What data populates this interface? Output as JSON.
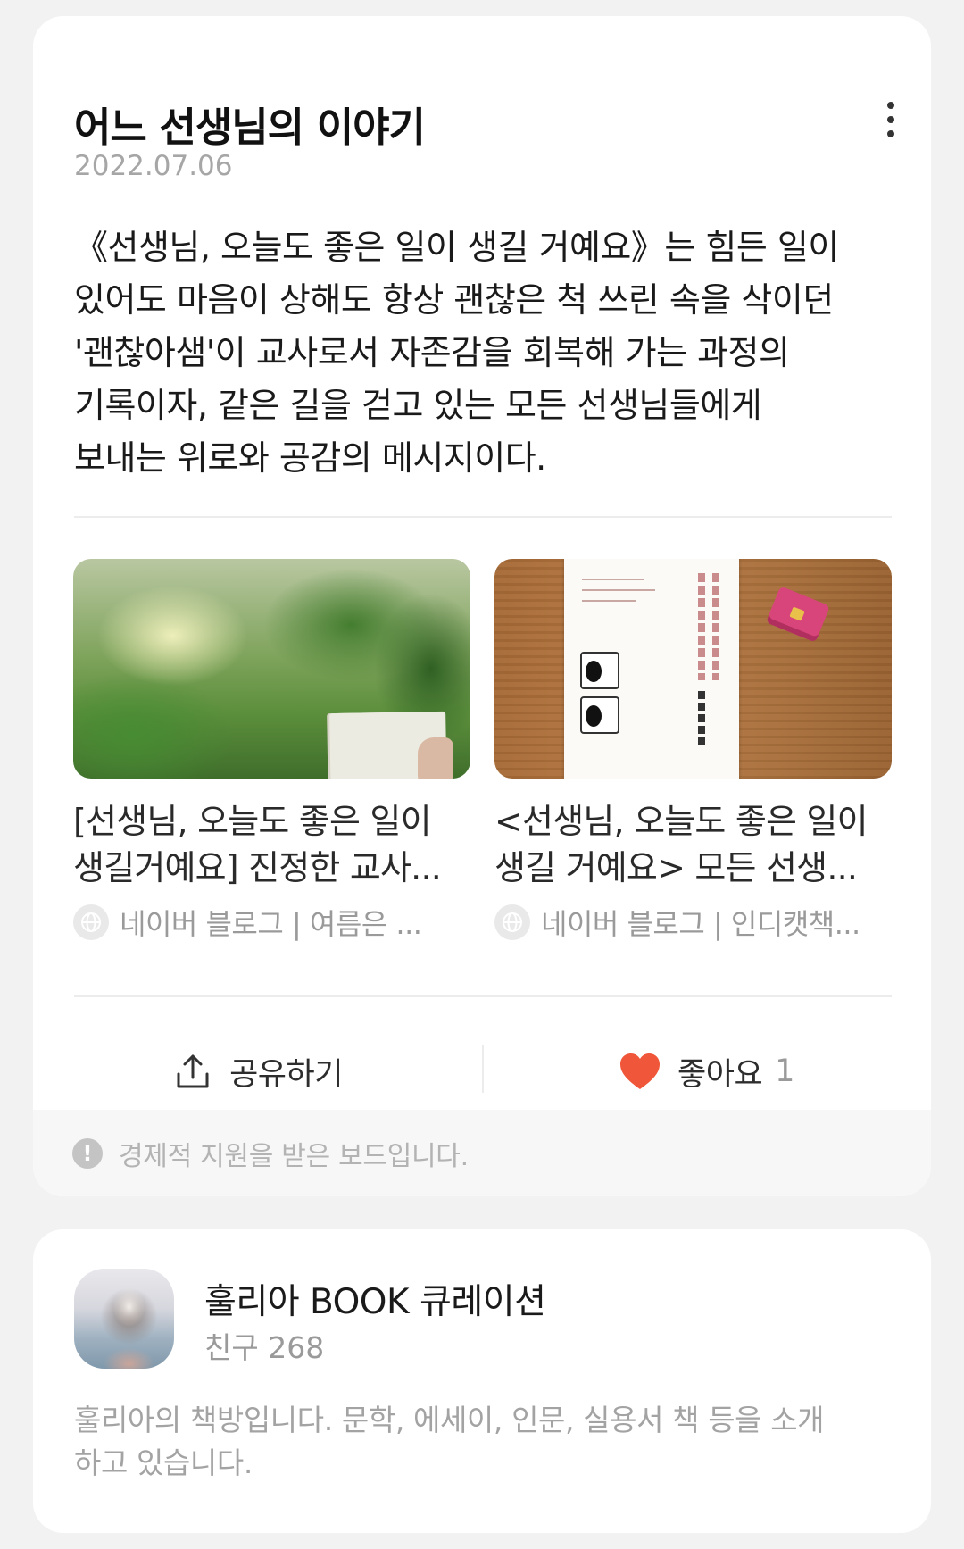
{
  "post": {
    "title": "어느 선생님의 이야기",
    "date": "2022.07.06",
    "body_lines": [
      "《선생님, 오늘도 좋은 일이 생길 거예요》는 힘든 일이",
      "있어도 마음이 상해도 항상 괜찮은 척 쓰린 속을 삭이던",
      "'괜찮아샘'이 교사로서 자존감을 회복해 가는 과정의",
      "기록이자, 같은 길을 걷고 있는 모든 선생님들에게",
      "보내는 위로와 공감의 메시지이다."
    ],
    "more_icon": "more-vertical-icon"
  },
  "links": [
    {
      "title_lines": [
        "[선생님, 오늘도 좋은 일이",
        "생길거예요] 진정한 교사..."
      ],
      "source": "네이버 블로그 | 여름은 ...",
      "icon": "globe-icon"
    },
    {
      "title_lines": [
        "<선생님, 오늘도 좋은 일이",
        "생길 거예요> 모든 선생..."
      ],
      "source": "네이버 블로그 | 인디캣책...",
      "icon": "globe-icon"
    }
  ],
  "actions": {
    "share_label": "공유하기",
    "share_icon": "share-icon",
    "like_label": "좋아요",
    "like_count": "1",
    "like_icon": "heart-icon"
  },
  "notice": {
    "text": "경제적 지원을 받은 보드입니다.",
    "icon": "info-icon"
  },
  "profile": {
    "name": "훌리아 BOOK 큐레이션",
    "friends": "친구 268",
    "description_lines": [
      "훌리아의 책방입니다. 문학, 에세이, 인문, 실용서 책 등을 소개",
      "하고 있습니다."
    ]
  },
  "colors": {
    "background": "#f2f2f2",
    "card": "#ffffff",
    "heart": "#f0573a",
    "muted_text": "#9a9a9a"
  }
}
